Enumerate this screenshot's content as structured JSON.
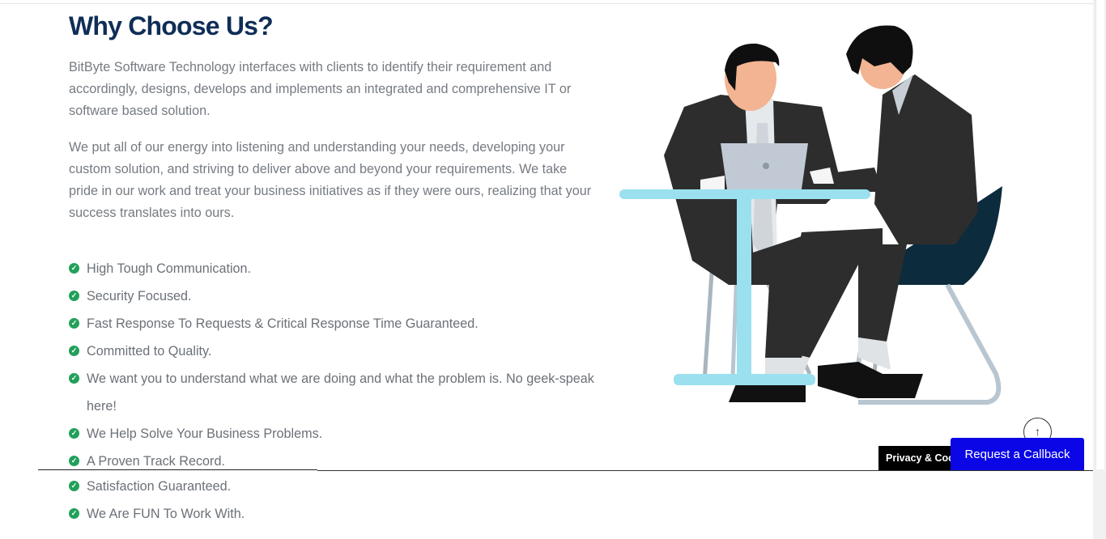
{
  "section": {
    "title": "Why Choose Us?",
    "paragraphs": [
      "BitByte Software Technology interfaces with clients to identify their requirement and accordingly, designs, develops and implements an integrated and comprehensive IT or software based solution.",
      "We put all of our energy into listening and understanding your needs, developing your custom solution, and striving to deliver above and beyond your requirements. We take pride in our work and treat your business initiatives as if they were ours, realizing that your success translates into ours."
    ],
    "features": [
      "High Tough Communication.",
      "Security Focused.",
      "Fast Response To Requests & Critical Response Time Guaranteed.",
      "Committed to Quality.",
      "We want you to understand what we are doing and what the problem is. No geek-speak here!",
      "We Help Solve Your Business Problems.",
      "A Proven Track Record.",
      "Satisfaction Guaranteed.",
      "We Are FUN To Work With."
    ]
  },
  "widgets": {
    "privacy_label": "Privacy & Cookies Policy",
    "callback_label": "Request a Callback",
    "scroll_top_icon": "↑"
  },
  "colors": {
    "title": "#0f2e57",
    "check": "#22a05a",
    "callback_bg": "#0a06e6"
  },
  "icons": {
    "check": "check-circle-icon",
    "scroll_top": "arrow-up-icon"
  }
}
